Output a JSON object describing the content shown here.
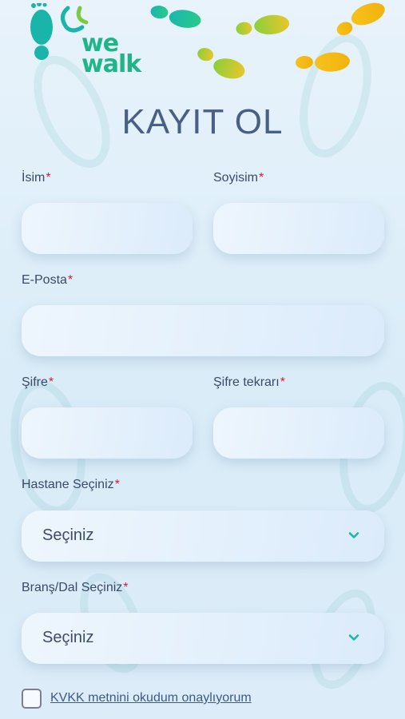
{
  "title": "KAYIT OL",
  "logo": {
    "line1": "we",
    "line2": "walk"
  },
  "required_mark": "*",
  "fields": {
    "first_name": {
      "label": "İsim",
      "value": ""
    },
    "last_name": {
      "label": "Soyisim",
      "value": ""
    },
    "email": {
      "label": "E-Posta",
      "value": ""
    },
    "password": {
      "label": "Şifre",
      "value": ""
    },
    "password_repeat": {
      "label": "Şifre tekrarı",
      "value": ""
    }
  },
  "hospital": {
    "label": "Hastane Seçiniz",
    "selected": "Seçiniz"
  },
  "branch": {
    "label": "Branş/Dal Seçiniz",
    "selected": "Seçiniz"
  },
  "kvkk": {
    "label": "KVKK metnini okudum onaylıyorum",
    "checked": false
  },
  "colors": {
    "accent": "#16b8b0",
    "required": "#d61f3c",
    "title": "#4a5f86",
    "logo": "#1fb589"
  }
}
